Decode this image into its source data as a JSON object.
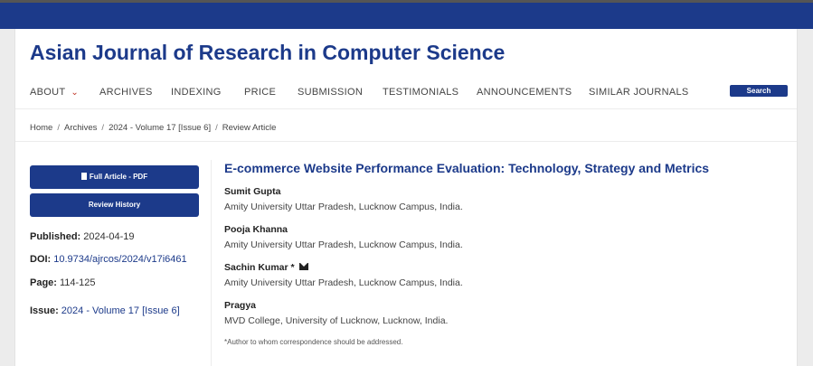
{
  "journal": {
    "title": "Asian Journal of Research in Computer Science"
  },
  "nav": {
    "items": [
      "ABOUT",
      "ARCHIVES",
      "INDEXING",
      "PRICE",
      "SUBMISSION",
      "TESTIMONIALS",
      "ANNOUNCEMENTS",
      "SIMILAR JOURNALS"
    ],
    "search_label": "Search"
  },
  "breadcrumb": {
    "items": [
      "Home",
      "Archives",
      "2024 - Volume 17 [Issue 6]",
      "Review Article"
    ],
    "separator": "/"
  },
  "sidebar": {
    "full_article_label": "Full Article - PDF",
    "review_history_label": "Review History",
    "published_label": "Published:",
    "published_value": "2024-04-19",
    "doi_label": "DOI:",
    "doi_value": "10.9734/ajrcos/2024/v17i6461",
    "page_label": "Page:",
    "page_value": "114-125",
    "issue_label": "Issue:",
    "issue_value": "2024 - Volume 17 [Issue 6]"
  },
  "article": {
    "title": "E-commerce Website Performance Evaluation: Technology, Strategy and Metrics",
    "authors": [
      {
        "name": "Sumit Gupta",
        "affiliation": "Amity University Uttar Pradesh, Lucknow Campus, India."
      },
      {
        "name": "Pooja Khanna",
        "affiliation": "Amity University Uttar Pradesh, Lucknow Campus, India."
      },
      {
        "name": "Sachin Kumar *",
        "affiliation": "Amity University Uttar Pradesh, Lucknow Campus, India."
      },
      {
        "name": "Pragya",
        "affiliation": "MVD College, University of Lucknow, Lucknow, India."
      }
    ],
    "correspondence_note": "*Author to whom correspondence should be addressed."
  },
  "icons": {
    "dropdown": "chevron-down-icon",
    "pdf": "pdf-icon",
    "email": "envelope-icon"
  },
  "colors": {
    "brand": "#1c3a8a",
    "accent": "#c0392b"
  }
}
